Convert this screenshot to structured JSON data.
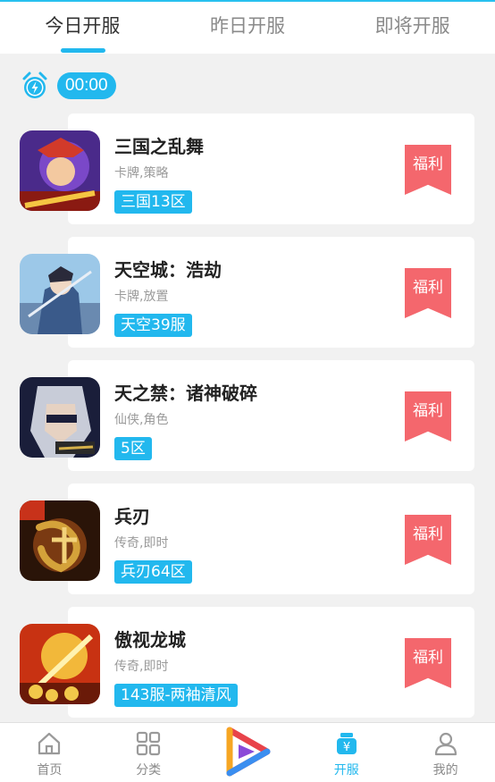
{
  "tabs": [
    {
      "label": "今日开服",
      "active": true
    },
    {
      "label": "昨日开服",
      "active": false
    },
    {
      "label": "即将开服",
      "active": false
    }
  ],
  "timeline": {
    "time": "00:00",
    "icon": "alarm-clock-icon"
  },
  "games": [
    {
      "title": "三国之乱舞",
      "tags": "卡牌,策略",
      "server": "三国13区",
      "badge": "福利",
      "thumb_colors": [
        "#4a2a8a",
        "#d23a2a",
        "#f5c542"
      ]
    },
    {
      "title": "天空城：浩劫",
      "tags": "卡牌,放置",
      "server": "天空39服",
      "badge": "福利",
      "thumb_colors": [
        "#9cc8e8",
        "#3a5a8a",
        "#e8eef6"
      ]
    },
    {
      "title": "天之禁：诸神破碎",
      "tags": "仙侠,角色",
      "server": "5区",
      "badge": "福利",
      "thumb_colors": [
        "#1a1e3a",
        "#c8ccd8",
        "#6a6e8a"
      ]
    },
    {
      "title": "兵刃",
      "tags": "传奇,即时",
      "server": "兵刃64区",
      "badge": "福利",
      "thumb_colors": [
        "#2a1408",
        "#d4a23a",
        "#7a3a12"
      ]
    },
    {
      "title": "傲视龙城",
      "tags": "传奇,即时",
      "server": "143服-两袖清风",
      "badge": "福利",
      "thumb_colors": [
        "#c83212",
        "#f2b83a",
        "#6a1a08"
      ]
    }
  ],
  "bottom_nav": [
    {
      "label": "首页",
      "icon": "home-icon",
      "active": false
    },
    {
      "label": "分类",
      "icon": "grid-icon",
      "active": false
    },
    {
      "label": "",
      "icon": "play-logo-icon",
      "active": false
    },
    {
      "label": "开服",
      "icon": "server-bag-icon",
      "active": true
    },
    {
      "label": "我的",
      "icon": "user-icon",
      "active": false
    }
  ],
  "colors": {
    "accent": "#22b8ee",
    "badge": "#f4676d",
    "background": "#f1f1f1"
  }
}
